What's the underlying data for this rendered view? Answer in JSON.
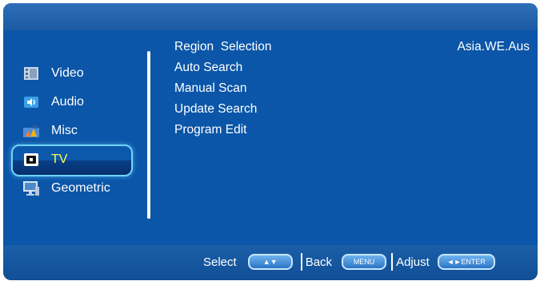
{
  "sidebar": {
    "items": [
      {
        "label": "Video",
        "icon": "video-icon"
      },
      {
        "label": "Audio",
        "icon": "audio-icon"
      },
      {
        "label": "Misc",
        "icon": "misc-icon"
      },
      {
        "label": "TV",
        "icon": "tv-icon",
        "selected": true
      },
      {
        "label": "Geometric",
        "icon": "geometric-icon"
      }
    ]
  },
  "menu": {
    "items": [
      {
        "label": "Region  Selection",
        "value": "Asia.WE.Aus"
      },
      {
        "label": "Auto Search"
      },
      {
        "label": "Manual Scan"
      },
      {
        "label": "Update Search"
      },
      {
        "label": "Program Edit"
      }
    ]
  },
  "hints": {
    "select_label": "Select",
    "select_key": "▲▼",
    "back_label": "Back",
    "back_key": "MENU",
    "adjust_label": "Adjust",
    "adjust_key": "◄►ENTER"
  },
  "colors": {
    "background": "#0b56a8",
    "selected_text": "#ffff4d",
    "highlight_border": "#6fd3ff"
  }
}
